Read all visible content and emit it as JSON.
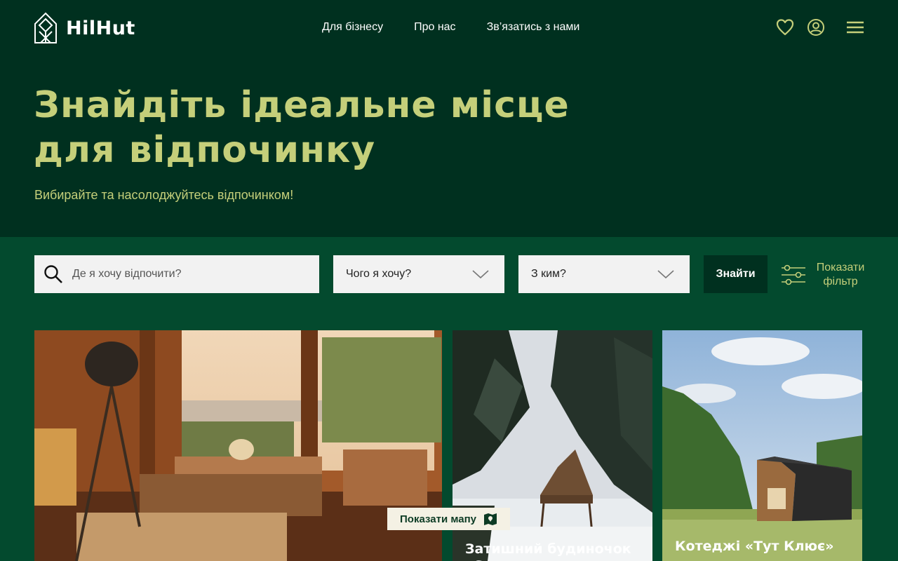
{
  "brand": {
    "name": "HilHut"
  },
  "nav": [
    {
      "label": "Для бізнесу"
    },
    {
      "label": "Про нас"
    },
    {
      "label": "Зв’язатись з нами"
    }
  ],
  "header_icons": [
    "heart-icon",
    "user-icon",
    "menu-icon"
  ],
  "hero": {
    "title_line1": "Знайдіть ідеальне місце",
    "title_line2": "для відпочинку",
    "subtitle": "Вибирайте та насолоджуйтесь відпочинком!"
  },
  "search": {
    "where_placeholder": "Де я хочу відпочити?",
    "what_label": "Чого я хочу?",
    "who_label": "З ким?",
    "find_button": "Знайти",
    "filter_toggle": "Показати фільтр"
  },
  "cards": [
    {
      "title": ""
    },
    {
      "title": "Затишний будиночок «S-"
    },
    {
      "title": "Котеджі «Тут Клює»"
    }
  ],
  "map_button": {
    "label": "Показати мапу"
  },
  "colors": {
    "background": "#00301f",
    "search_band": "#034a2e",
    "accent": "#c5cf7a",
    "field_bg": "#f2f2f2",
    "map_button_bg": "#f4f1e4"
  }
}
